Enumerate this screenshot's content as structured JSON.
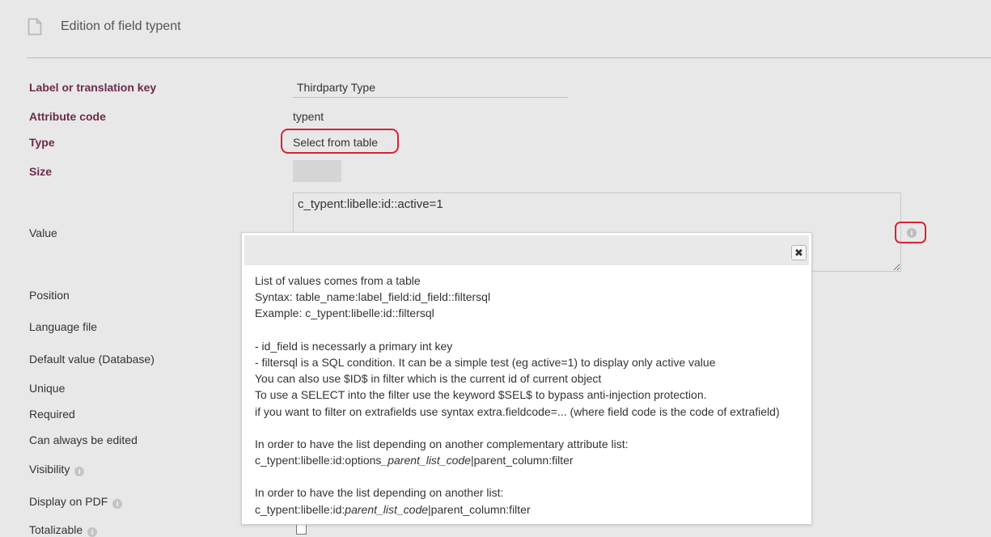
{
  "page": {
    "title": "Edition of field typent"
  },
  "form": {
    "label_key": {
      "label": "Label or translation key",
      "value": "Thirdparty Type"
    },
    "attribute_code": {
      "label": "Attribute code",
      "value": "typent"
    },
    "type": {
      "label": "Type",
      "value": "Select from table"
    },
    "size": {
      "label": "Size",
      "value": ""
    },
    "value": {
      "label": "Value",
      "content": "c_typent:libelle:id::active=1"
    },
    "position": {
      "label": "Position"
    },
    "language_file": {
      "label": "Language file"
    },
    "default_value": {
      "label": "Default value (Database)"
    },
    "unique": {
      "label": "Unique"
    },
    "required": {
      "label": "Required"
    },
    "always_editable": {
      "label": "Can always be edited"
    },
    "visibility": {
      "label": "Visibility"
    },
    "display_on_pdf": {
      "label": "Display on PDF"
    },
    "totalizable": {
      "label": "Totalizable"
    }
  },
  "icons": {
    "document": "document-icon",
    "info": "info-icon",
    "close": "close-icon"
  },
  "colors": {
    "required_label": "#6b2b4a",
    "highlight": "#d92233",
    "background": "#e8e8e8"
  },
  "tooltip": {
    "close_symbol": "✖",
    "lines": [
      "List of values comes from a table",
      "Syntax: table_name:label_field:id_field::filtersql",
      "Example: c_typent:libelle:id::filtersql",
      "",
      "- id_field is necessarly a primary int key",
      "- filtersql is a SQL condition. It can be a simple test (eg active=1) to display only active value",
      "You can also use $ID$ in filter which is the current id of current object",
      "To use a SELECT into the filter use the keyword $SEL$ to bypass anti-injection protection.",
      "if you want to filter on extrafields use syntax extra.fieldcode=... (where field code is the code of extrafield)",
      "",
      "In order to have the list depending on another complementary attribute list:"
    ],
    "line_options": {
      "prefix": "c_typent:libelle:id:options",
      "italic": "_parent_list_code",
      "suffix": "|parent_column:filter"
    },
    "heading2": "In order to have the list depending on another list:",
    "line_parent": {
      "prefix": "c_typent:libelle:id:",
      "italic": "parent_list_code",
      "suffix": "|parent_column:filter"
    }
  }
}
